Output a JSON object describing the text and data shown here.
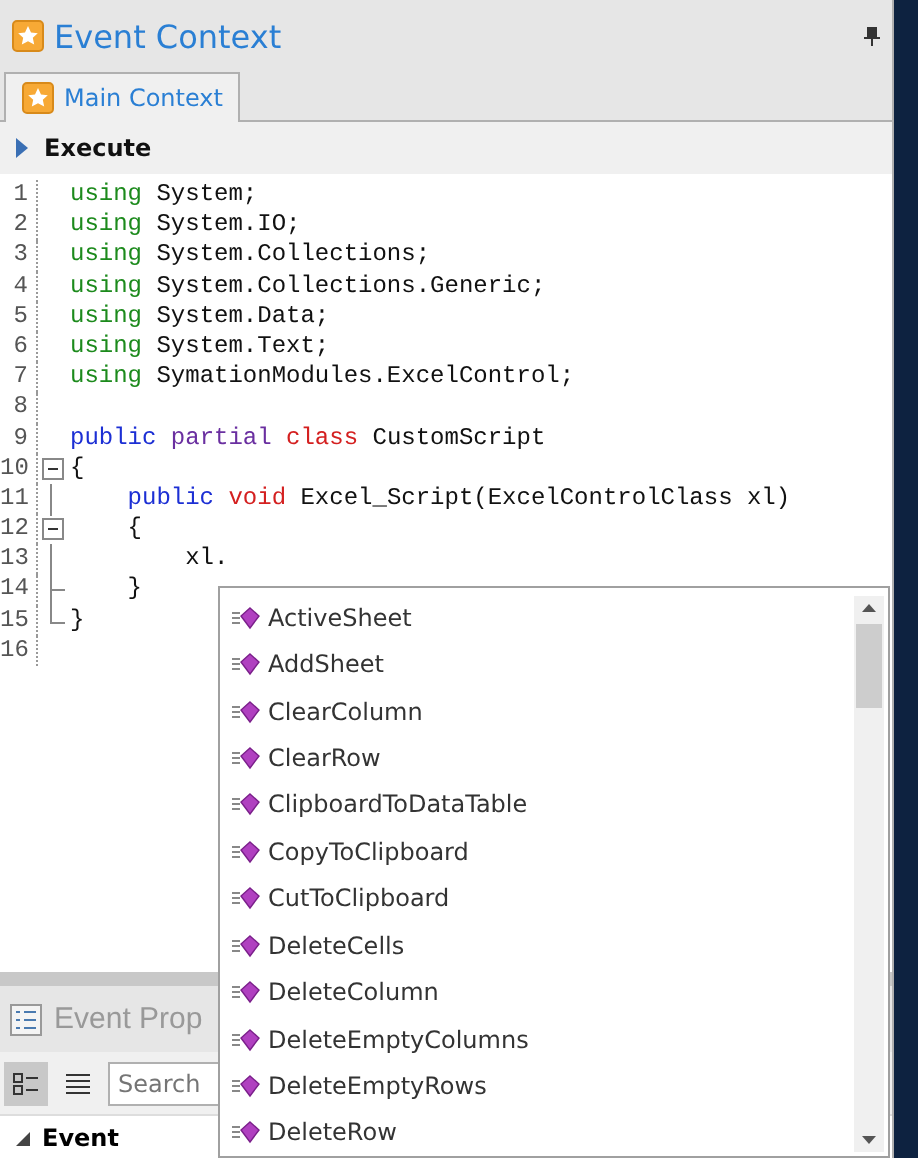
{
  "window": {
    "title": "Event Context"
  },
  "tabs": [
    {
      "label": "Main Context",
      "selected": true
    }
  ],
  "toolbar": {
    "execute": "Execute"
  },
  "editor": {
    "lines": [
      {
        "number": "1",
        "kind": "plain",
        "tokens": [
          {
            "kind": "using",
            "text": "using"
          },
          {
            "kind": "plain",
            "text": " System;"
          }
        ]
      },
      {
        "number": "2",
        "kind": "plain",
        "tokens": [
          {
            "kind": "using",
            "text": "using"
          },
          {
            "kind": "plain",
            "text": " System.IO;"
          }
        ]
      },
      {
        "number": "3",
        "kind": "plain",
        "tokens": [
          {
            "kind": "using",
            "text": "using"
          },
          {
            "kind": "plain",
            "text": " System.Collections;"
          }
        ]
      },
      {
        "number": "4",
        "kind": "plain",
        "tokens": [
          {
            "kind": "using",
            "text": "using"
          },
          {
            "kind": "plain",
            "text": " System.Collections.Generic;"
          }
        ]
      },
      {
        "number": "5",
        "kind": "plain",
        "tokens": [
          {
            "kind": "using",
            "text": "using"
          },
          {
            "kind": "plain",
            "text": " System.Data;"
          }
        ]
      },
      {
        "number": "6",
        "kind": "plain",
        "tokens": [
          {
            "kind": "using",
            "text": "using"
          },
          {
            "kind": "plain",
            "text": " System.Text;"
          }
        ]
      },
      {
        "number": "7",
        "kind": "plain",
        "tokens": [
          {
            "kind": "using",
            "text": "using"
          },
          {
            "kind": "plain",
            "text": " SymationModules.ExcelControl;"
          }
        ]
      },
      {
        "number": "8",
        "kind": "plain"
      },
      {
        "number": "9",
        "kind": "plain",
        "tokens": [
          {
            "kind": "modifier",
            "text": "public "
          },
          {
            "kind": "modifier2",
            "text": "partial "
          },
          {
            "kind": "type",
            "text": "class "
          },
          {
            "kind": "plain",
            "text": "CustomScript"
          }
        ]
      },
      {
        "number": "10",
        "kind": "foldstart",
        "tokens": [
          {
            "kind": "plain",
            "text": "{"
          }
        ]
      },
      {
        "number": "11",
        "kind": "foldline",
        "tokens": [
          {
            "kind": "modifier",
            "text": "    public "
          },
          {
            "kind": "type",
            "text": "void "
          },
          {
            "kind": "plain",
            "text": "Excel_Script(ExcelControlClass xl)"
          }
        ]
      },
      {
        "number": "12",
        "kind": "foldstart",
        "tokens": [
          {
            "kind": "plain",
            "text": "    {"
          }
        ]
      },
      {
        "number": "13",
        "kind": "foldline",
        "tokens": [
          {
            "kind": "plain",
            "text": "        xl."
          }
        ]
      },
      {
        "number": "14",
        "kind": "foldbranch",
        "tokens": [
          {
            "kind": "plain",
            "text": "    }"
          }
        ]
      },
      {
        "number": "15",
        "kind": "foldend",
        "tokens": [
          {
            "kind": "plain",
            "text": "}"
          }
        ]
      },
      {
        "number": "16",
        "kind": "plain"
      }
    ]
  },
  "completion": {
    "items": [
      {
        "label": "ActiveSheet"
      },
      {
        "label": "AddSheet"
      },
      {
        "label": "ClearColumn"
      },
      {
        "label": "ClearRow"
      },
      {
        "label": "ClipboardToDataTable"
      },
      {
        "label": "CopyToClipboard"
      },
      {
        "label": "CutToClipboard"
      },
      {
        "label": "DeleteCells"
      },
      {
        "label": "DeleteColumn"
      },
      {
        "label": "DeleteEmptyColumns"
      },
      {
        "label": "DeleteEmptyRows"
      },
      {
        "label": "DeleteRow"
      }
    ]
  },
  "properties": {
    "title": "Event Prop",
    "search": {
      "placeholder": "Search"
    },
    "group": {
      "label": "Event",
      "expanded": true
    }
  }
}
